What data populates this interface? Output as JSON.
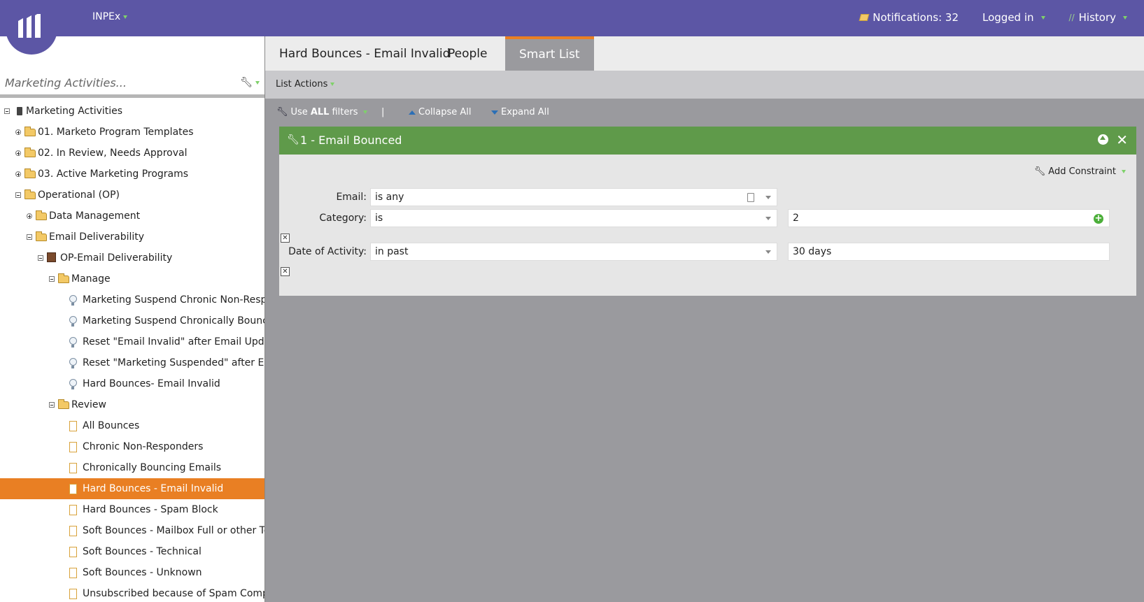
{
  "topbar": {
    "workspace": "INPEx",
    "notifications": "Notifications: 32",
    "logged_in": "Logged in",
    "history": "History"
  },
  "search": {
    "placeholder": "Marketing Activities..."
  },
  "tree": [
    {
      "label": "Marketing Activities",
      "level": 0,
      "icon": "root-icon",
      "toggle": "minus"
    },
    {
      "label": "01. Marketo Program Templates",
      "level": 1,
      "icon": "folder-icon",
      "toggle": "plus"
    },
    {
      "label": "02. In Review, Needs Approval",
      "level": 1,
      "icon": "folder-icon",
      "toggle": "plus"
    },
    {
      "label": "03. Active Marketing Programs",
      "level": 1,
      "icon": "folder-icon",
      "toggle": "plus"
    },
    {
      "label": "Operational (OP)",
      "level": 1,
      "icon": "folder-icon",
      "toggle": "minus"
    },
    {
      "label": "Data Management",
      "level": 2,
      "icon": "folder-icon",
      "toggle": "plus"
    },
    {
      "label": "Email Deliverability",
      "level": 2,
      "icon": "folder-icon",
      "toggle": "minus"
    },
    {
      "label": "OP-Email Deliverability",
      "level": 3,
      "icon": "program-icon",
      "toggle": "minus"
    },
    {
      "label": "Manage",
      "level": 4,
      "icon": "folder-icon",
      "toggle": "minus"
    },
    {
      "label": "Marketing Suspend Chronic Non-Responders",
      "level": 5,
      "icon": "campaign-icon"
    },
    {
      "label": "Marketing Suspend Chronically Bouncing Emails",
      "level": 5,
      "icon": "campaign-icon"
    },
    {
      "label": "Reset \"Email Invalid\" after Email Update",
      "level": 5,
      "icon": "campaign-icon"
    },
    {
      "label": "Reset \"Marketing Suspended\" after Email Update",
      "level": 5,
      "icon": "campaign-icon"
    },
    {
      "label": "Hard Bounces- Email Invalid",
      "level": 5,
      "icon": "campaign-icon"
    },
    {
      "label": "Review",
      "level": 4,
      "icon": "folder-icon",
      "toggle": "minus"
    },
    {
      "label": "All Bounces",
      "level": 5,
      "icon": "list-icon"
    },
    {
      "label": "Chronic Non-Responders",
      "level": 5,
      "icon": "list-icon"
    },
    {
      "label": "Chronically Bouncing Emails",
      "level": 5,
      "icon": "list-icon"
    },
    {
      "label": "Hard Bounces - Email Invalid",
      "level": 5,
      "icon": "list-icon",
      "selected": true
    },
    {
      "label": "Hard Bounces - Spam Block",
      "level": 5,
      "icon": "list-icon"
    },
    {
      "label": "Soft Bounces - Mailbox Full or other Technical",
      "level": 5,
      "icon": "list-icon"
    },
    {
      "label": "Soft Bounces - Technical",
      "level": 5,
      "icon": "list-icon"
    },
    {
      "label": "Soft Bounces - Unknown",
      "level": 5,
      "icon": "list-icon"
    },
    {
      "label": "Unsubscribed because of Spam Complaint",
      "level": 5,
      "icon": "list-icon"
    }
  ],
  "tabs": [
    {
      "label": "Hard Bounces - Email Invalid"
    },
    {
      "label": "People"
    },
    {
      "label": "Smart List",
      "active": true
    }
  ],
  "list_actions": "List Actions",
  "filter_bar": {
    "use_all_prefix": "Use ",
    "use_all_bold": "ALL",
    "use_all_suffix": " filters",
    "separator": "|",
    "collapse_all": "Collapse All",
    "expand_all": "Expand All"
  },
  "filter": {
    "title": "1 - Email Bounced",
    "add_constraint": "Add Constraint",
    "email_label": "Email:",
    "email_value": "is any",
    "category_label": "Category:",
    "category_op": "is",
    "category_value": "2",
    "date_label": "Date of Activity:",
    "date_op": "in past",
    "date_value": "30 days"
  },
  "colors": {
    "topbar": "#5c56a5",
    "accent": "#e97f23",
    "filter_header": "#5f9a4a"
  }
}
